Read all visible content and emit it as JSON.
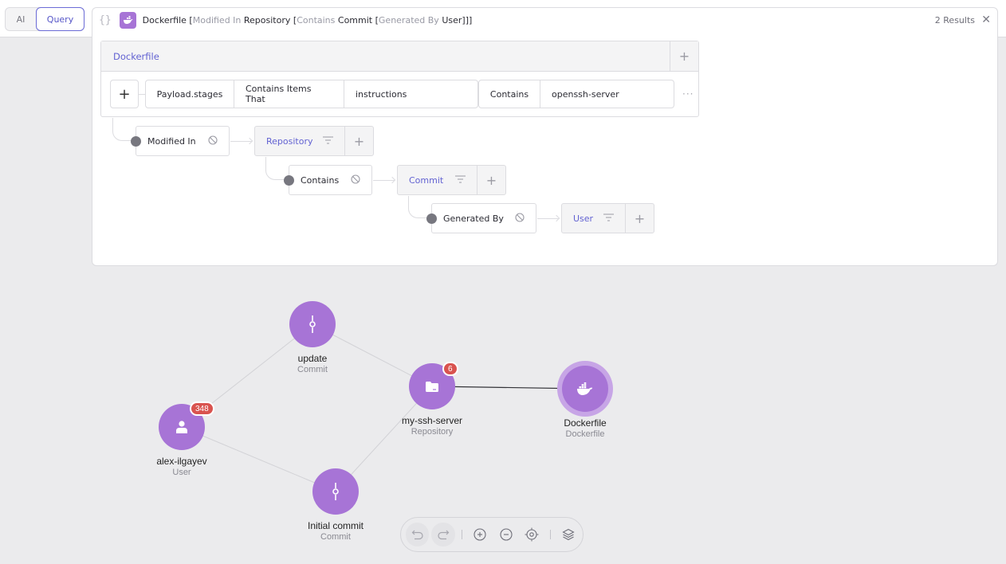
{
  "mode_toggle": {
    "options": [
      "AI",
      "Query"
    ],
    "active": "Query"
  },
  "query_bar": {
    "braces_icon": "code-braces-icon",
    "entity_icon": "docker-whale-icon",
    "segments": [
      {
        "text": "Dockerfile",
        "kind": "entity"
      },
      {
        "text": " [",
        "kind": "entity"
      },
      {
        "text": "Modified In",
        "kind": "keyword"
      },
      {
        "text": " Repository",
        "kind": "entity"
      },
      {
        "text": " [",
        "kind": "entity"
      },
      {
        "text": "Contains",
        "kind": "keyword"
      },
      {
        "text": " Commit",
        "kind": "entity"
      },
      {
        "text": " [",
        "kind": "entity"
      },
      {
        "text": "Generated By",
        "kind": "keyword"
      },
      {
        "text": " User",
        "kind": "entity"
      },
      {
        "text": "]]]",
        "kind": "entity"
      }
    ],
    "results": "2 Results",
    "close_icon": "close-icon"
  },
  "query_builder": {
    "root": {
      "title": "Dockerfile",
      "add_icon": "plus-icon",
      "filter": {
        "add_label": "+",
        "field": "Payload.stages",
        "operator": "Contains Items That",
        "subfield": "instructions",
        "sub_operator": "Contains",
        "value": "openssh-server",
        "more_icon": "ellipsis-icon"
      }
    },
    "relations": [
      {
        "relation": "Modified In",
        "entity": "Repository"
      },
      {
        "relation": "Contains",
        "entity": "Commit"
      },
      {
        "relation": "Generated By",
        "entity": "User"
      }
    ]
  },
  "graph": {
    "node_color": "#a774d6",
    "badge_color": "#d9534f",
    "nodes": [
      {
        "id": "update",
        "name": "update",
        "type": "Commit",
        "icon": "commit-icon"
      },
      {
        "id": "repo",
        "name": "my-ssh-server",
        "type": "Repository",
        "icon": "folder-icon",
        "badge": "6"
      },
      {
        "id": "dockerfile",
        "name": "Dockerfile",
        "type": "Dockerfile",
        "icon": "docker-whale-icon",
        "selected": true
      },
      {
        "id": "user",
        "name": "alex-ilgayev",
        "type": "User",
        "icon": "user-icon",
        "badge": "348"
      },
      {
        "id": "initial",
        "name": "Initial commit",
        "type": "Commit",
        "icon": "commit-icon"
      }
    ],
    "edges": [
      [
        "user",
        "update"
      ],
      [
        "update",
        "repo"
      ],
      [
        "repo",
        "dockerfile"
      ],
      [
        "user",
        "initial"
      ],
      [
        "initial",
        "repo"
      ]
    ]
  },
  "toolbar": {
    "buttons": [
      {
        "name": "undo-button",
        "icon": "undo-icon",
        "disabled": true
      },
      {
        "name": "redo-button",
        "icon": "redo-icon",
        "disabled": true
      },
      {
        "name": "zoom-in-button",
        "icon": "zoom-in-icon"
      },
      {
        "name": "zoom-out-button",
        "icon": "zoom-out-icon"
      },
      {
        "name": "center-button",
        "icon": "crosshair-icon"
      },
      {
        "name": "layers-button",
        "icon": "layers-icon"
      }
    ]
  }
}
